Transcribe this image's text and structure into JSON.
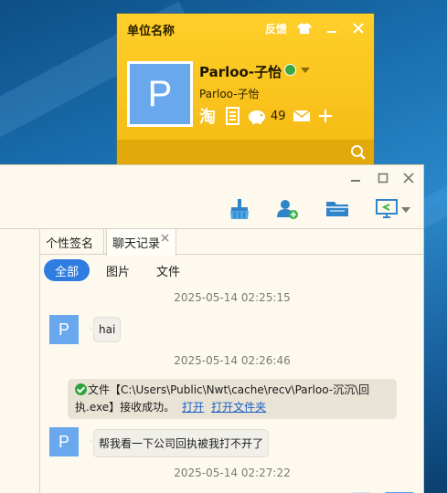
{
  "profile_card": {
    "title": "单位名称",
    "feedback_label": "反馈",
    "avatar_letter": "P",
    "name": "Parloo-子怡",
    "subtitle": "Parloo-子怡",
    "coin_count": "49"
  },
  "chat": {
    "tabs": [
      {
        "label": "个性签名"
      },
      {
        "label": "聊天记录"
      }
    ],
    "filters": [
      {
        "label": "全部"
      },
      {
        "label": "图片"
      },
      {
        "label": "文件"
      }
    ],
    "avatar_letter": "P",
    "messages": [
      {
        "timestamp": "2025-05-14 02:25:15",
        "text": "hai"
      },
      {
        "timestamp": "2025-05-14 02:26:46"
      },
      {
        "text": "帮我看一下公司回执被我打不开了"
      },
      {
        "timestamp": "2025-05-14 02:27:22"
      }
    ],
    "file_notice": {
      "line1": "文件【C:\\Users\\Public\\Nwt\\cache\\recv\\Parloo-沉沉\\回",
      "line2": "执.exe】接收成功。",
      "open_label": "打开",
      "open_folder_label": "打开文件夹"
    }
  },
  "colors": {
    "panel_yellow": "#f9c21c",
    "accent_blue": "#2f7de1",
    "avatar_blue": "#6aa8ee",
    "status_green": "#3aa744"
  }
}
